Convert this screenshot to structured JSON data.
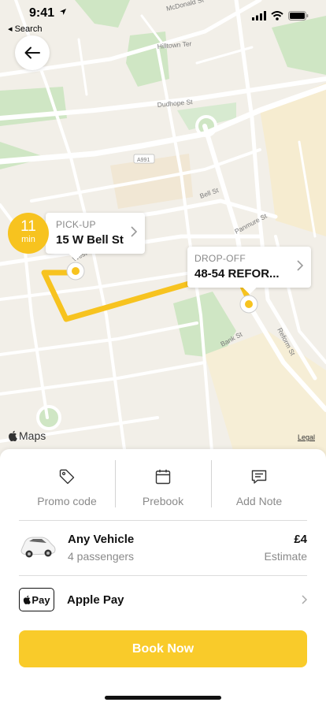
{
  "status_bar": {
    "time": "9:41",
    "back_label": "Search"
  },
  "map": {
    "streets": [
      "McDonald St",
      "Hilltown Ter",
      "Dudhope St",
      "A991",
      "Bell St",
      "Panmure St",
      "West Bell St",
      "Bank St",
      "Reform St"
    ],
    "attribution": "Maps",
    "legal": "Legal"
  },
  "eta": {
    "value": "11",
    "unit": "min"
  },
  "pickup": {
    "label": "PICK-UP",
    "address": "15 W Bell St"
  },
  "dropoff": {
    "label": "DROP-OFF",
    "address": "48-54 REFOR..."
  },
  "actions": [
    {
      "label": "Promo code",
      "icon": "tag-icon"
    },
    {
      "label": "Prebook",
      "icon": "calendar-icon"
    },
    {
      "label": "Add Note",
      "icon": "note-icon"
    }
  ],
  "vehicle": {
    "name": "Any Vehicle",
    "passengers": "4 passengers",
    "price": "£4",
    "price_note": "Estimate"
  },
  "payment": {
    "badge": "Pay",
    "label": "Apple Pay"
  },
  "book_button": "Book Now",
  "colors": {
    "accent": "#f9cb2a",
    "route": "#f7c31f",
    "map_bg": "#f2efe8",
    "park": "#cfe6c4"
  }
}
